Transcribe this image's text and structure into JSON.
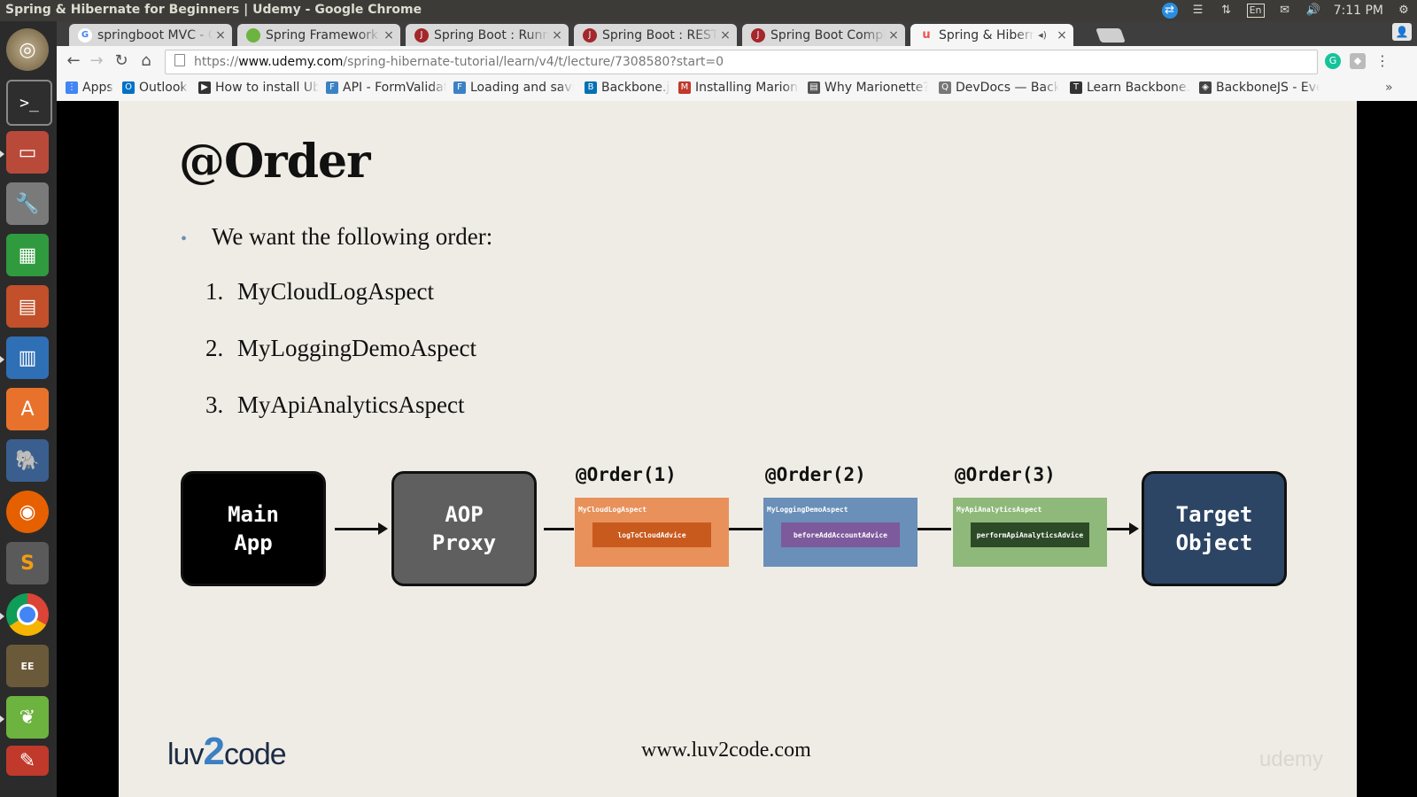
{
  "window": {
    "title": "Spring & Hibernate for Beginners | Udemy - Google Chrome"
  },
  "tray": {
    "lang": "En",
    "time": "7:11 PM"
  },
  "tabs": [
    {
      "label": "springboot MVC - Go",
      "favicon_color": "#ffffff",
      "favicon_glyph": "G"
    },
    {
      "label": "Spring Framework Do",
      "favicon_color": "#6db33f",
      "favicon_glyph": ""
    },
    {
      "label": "Spring Boot : Running",
      "favicon_color": "#a3272b",
      "favicon_glyph": "J"
    },
    {
      "label": "Spring Boot : RESTful",
      "favicon_color": "#a3272b",
      "favicon_glyph": "J"
    },
    {
      "label": "Spring Boot Complet",
      "favicon_color": "#a3272b",
      "favicon_glyph": "J"
    },
    {
      "label": "Spring & Hibernate",
      "favicon_color": "#ec5252",
      "favicon_glyph": "u"
    }
  ],
  "address": {
    "scheme": "https://",
    "domain": "www.udemy.com",
    "path": "/spring-hibernate-tutorial/learn/v4/t/lecture/7308580?start=0"
  },
  "bookmarks": [
    {
      "label": "Apps",
      "color": "#4285f4",
      "glyph": "⋮"
    },
    {
      "label": "Outlook",
      "color": "#0072c6",
      "glyph": "O"
    },
    {
      "label": "How to install Ubu",
      "color": "#333333",
      "glyph": "▶"
    },
    {
      "label": "API - FormValidati",
      "color": "#3b82c4",
      "glyph": "F"
    },
    {
      "label": "Loading and saving",
      "color": "#3b82c4",
      "glyph": "F"
    },
    {
      "label": "Backbone.js",
      "color": "#0071b5",
      "glyph": "B"
    },
    {
      "label": "Installing Marione",
      "color": "#c0392b",
      "glyph": "M"
    },
    {
      "label": "Why Marionette?",
      "color": "#555555",
      "glyph": "▤"
    },
    {
      "label": "DevDocs — Backb",
      "color": "#777777",
      "glyph": "Q"
    },
    {
      "label": "Learn Backbone.js",
      "color": "#333333",
      "glyph": "T"
    },
    {
      "label": "BackboneJS - Even",
      "color": "#444444",
      "glyph": "◈"
    }
  ],
  "slide": {
    "title": "@Order",
    "bullet": "We want the following order:",
    "list": [
      {
        "num": "1.",
        "text": "MyCloudLogAspect"
      },
      {
        "num": "2.",
        "text": "MyLoggingDemoAspect"
      },
      {
        "num": "3.",
        "text": "MyApiAnalyticsAspect"
      }
    ],
    "main_app": "Main App",
    "aop_proxy": "AOP Proxy",
    "target": "Target Object",
    "aspects": [
      {
        "order": "@Order(1)",
        "name": "MyCloudLogAspect",
        "advice": "logToCloudAdvice",
        "bg": "#e8915b",
        "inner": "#c95a1e"
      },
      {
        "order": "@Order(2)",
        "name": "MyLoggingDemoAspect",
        "advice": "beforeAddAccountAdvice",
        "bg": "#6a8fb8",
        "inner": "#7d5a9c"
      },
      {
        "order": "@Order(3)",
        "name": "MyApiAnalyticsAspect",
        "advice": "performApiAnalyticsAdvice",
        "bg": "#8fb97a",
        "inner": "#2d4a28"
      }
    ],
    "logo_pre": "luv",
    "logo_two": "2",
    "logo_post": "code",
    "footer_url": "www.luv2code.com",
    "watermark": "udemy"
  },
  "colors": {
    "main_app_bg": "#000000",
    "aop_proxy_bg": "#5f5f5f",
    "target_bg": "#2c4564"
  }
}
